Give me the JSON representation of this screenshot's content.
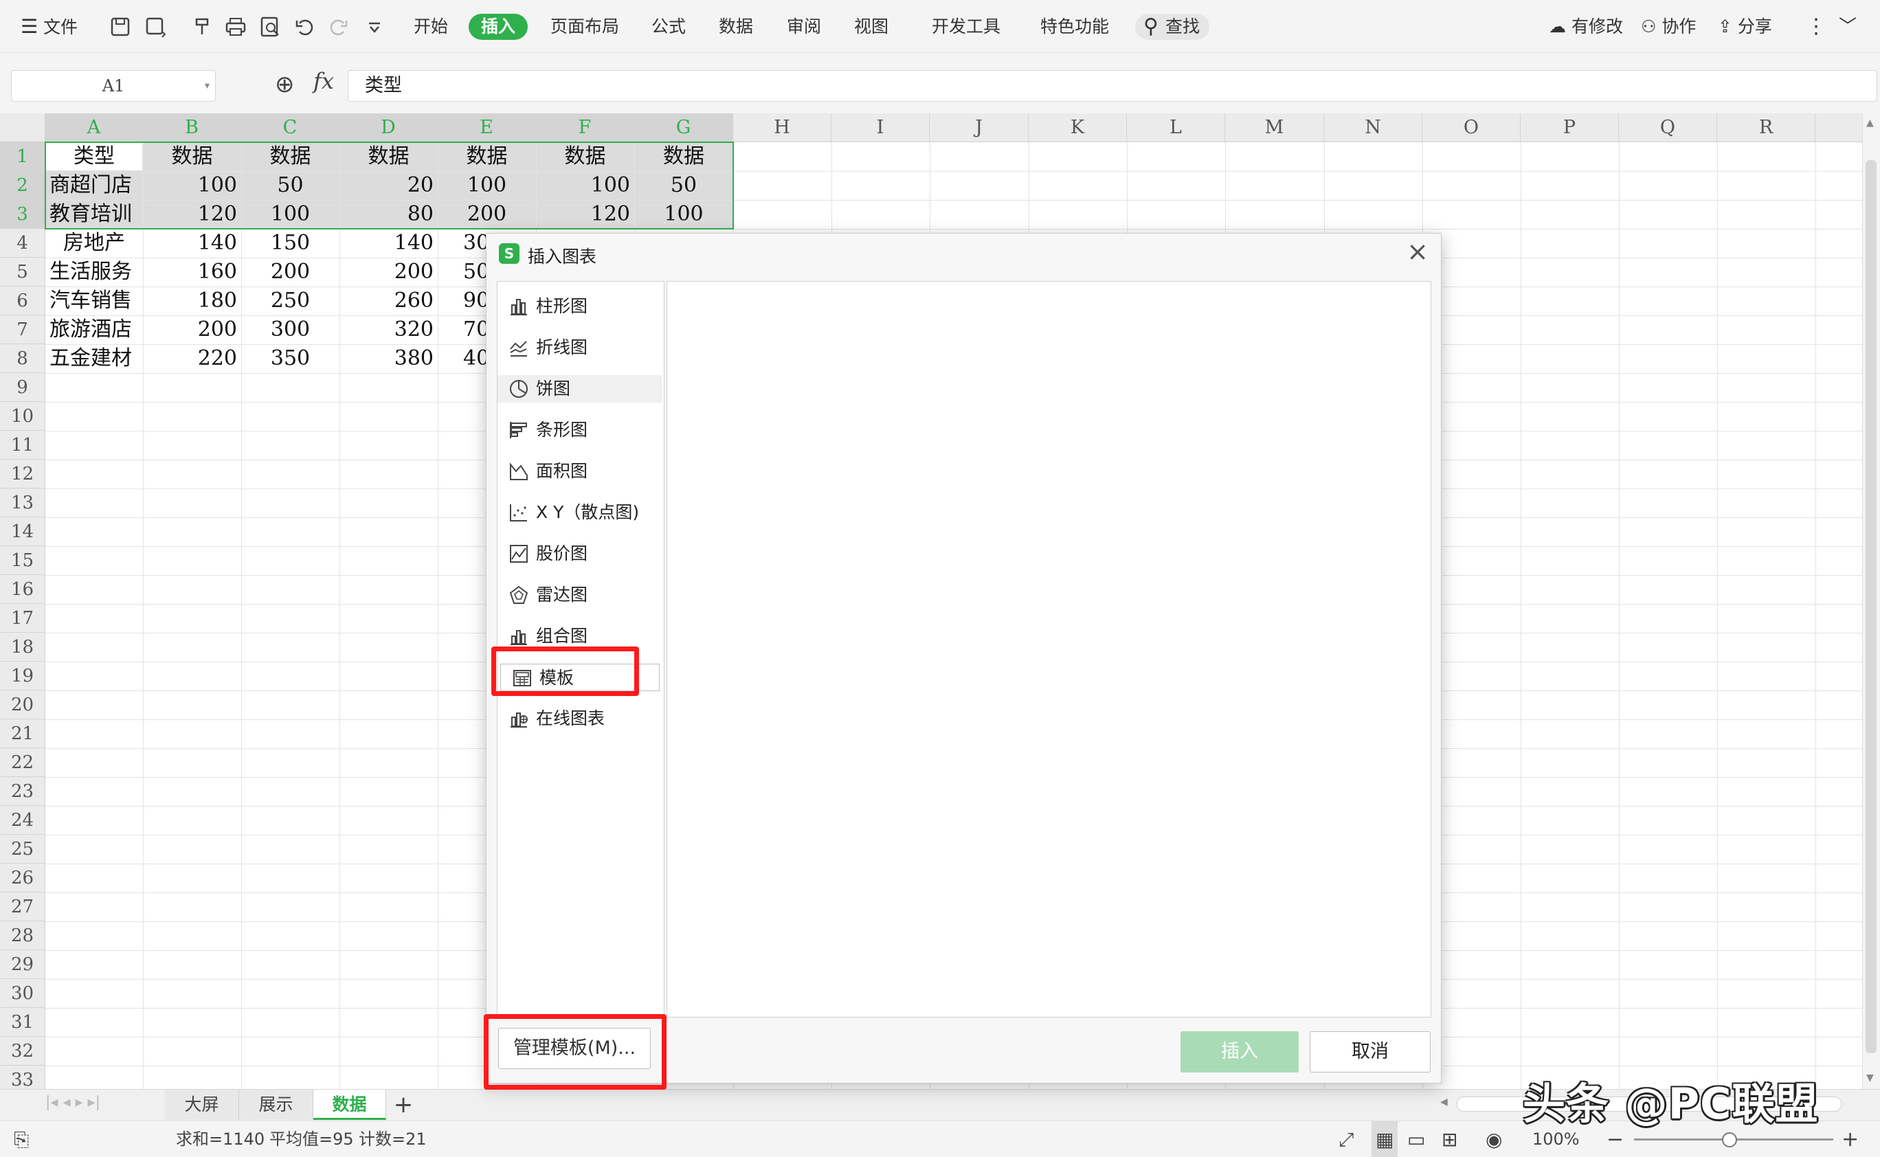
{
  "menubar": {
    "file": "文件",
    "tabs": [
      "开始",
      "插入",
      "页面布局",
      "公式",
      "数据",
      "审阅",
      "视图",
      "开发工具",
      "特色功能"
    ],
    "active_tab": "插入",
    "search": "查找",
    "right": {
      "modified": "有修改",
      "collab": "协作",
      "share": "分享"
    }
  },
  "formula_bar": {
    "cell_ref": "A1",
    "fx": "fx",
    "value": "类型"
  },
  "grid": {
    "columns": [
      "A",
      "B",
      "C",
      "D",
      "E",
      "F",
      "G",
      "H",
      "I",
      "J",
      "K",
      "L",
      "M",
      "N",
      "O",
      "P",
      "Q",
      "R"
    ],
    "rows": [
      "1",
      "2",
      "3",
      "4",
      "5",
      "6",
      "7",
      "8",
      "9",
      "10",
      "11",
      "12",
      "13",
      "14",
      "15",
      "16",
      "17",
      "18",
      "19",
      "20",
      "21",
      "22",
      "23",
      "24",
      "25",
      "26",
      "27",
      "28",
      "29",
      "30",
      "31",
      "32",
      "33"
    ],
    "data": [
      [
        "类型",
        "数据",
        "数据",
        "数据",
        "数据",
        "数据",
        "数据"
      ],
      [
        "商超门店",
        "100",
        "50",
        "20",
        "100",
        "100",
        "50"
      ],
      [
        "教育培训",
        "120",
        "100",
        "80",
        "200",
        "120",
        "100"
      ],
      [
        "房地产",
        "140",
        "150",
        "140",
        "30",
        "",
        ""
      ],
      [
        "生活服务",
        "160",
        "200",
        "200",
        "50",
        "",
        ""
      ],
      [
        "汽车销售",
        "180",
        "250",
        "260",
        "90",
        "",
        ""
      ],
      [
        "旅游酒店",
        "200",
        "300",
        "320",
        "70",
        "",
        ""
      ],
      [
        "五金建材",
        "220",
        "350",
        "380",
        "40",
        "",
        ""
      ]
    ]
  },
  "sheets": {
    "tabs": [
      "大屏",
      "展示",
      "数据"
    ],
    "active": "数据",
    "add": "+"
  },
  "status": {
    "sum": "求和=1140",
    "avg": "平均值=95",
    "count": "计数=21",
    "zoom": "100%"
  },
  "dialog": {
    "title": "插入图表",
    "close": "×",
    "chart_types": [
      {
        "label": "柱形图",
        "icon": "column-chart-icon"
      },
      {
        "label": "折线图",
        "icon": "line-chart-icon"
      },
      {
        "label": "饼图",
        "icon": "pie-chart-icon"
      },
      {
        "label": "条形图",
        "icon": "bar-chart-icon"
      },
      {
        "label": "面积图",
        "icon": "area-chart-icon"
      },
      {
        "label": "X Y（散点图)",
        "icon": "scatter-chart-icon"
      },
      {
        "label": "股价图",
        "icon": "stock-chart-icon"
      },
      {
        "label": "雷达图",
        "icon": "radar-chart-icon"
      },
      {
        "label": "组合图",
        "icon": "combo-chart-icon"
      },
      {
        "label": "模板",
        "icon": "template-icon"
      },
      {
        "label": "在线图表",
        "icon": "online-chart-icon"
      }
    ],
    "manage_button": "管理模板(M)...",
    "insert_button": "插入",
    "cancel_button": "取消"
  },
  "watermark": "头条 @PC联盟",
  "colors": {
    "accent": "#2fb04d",
    "highlight": "#ff1a1a"
  }
}
